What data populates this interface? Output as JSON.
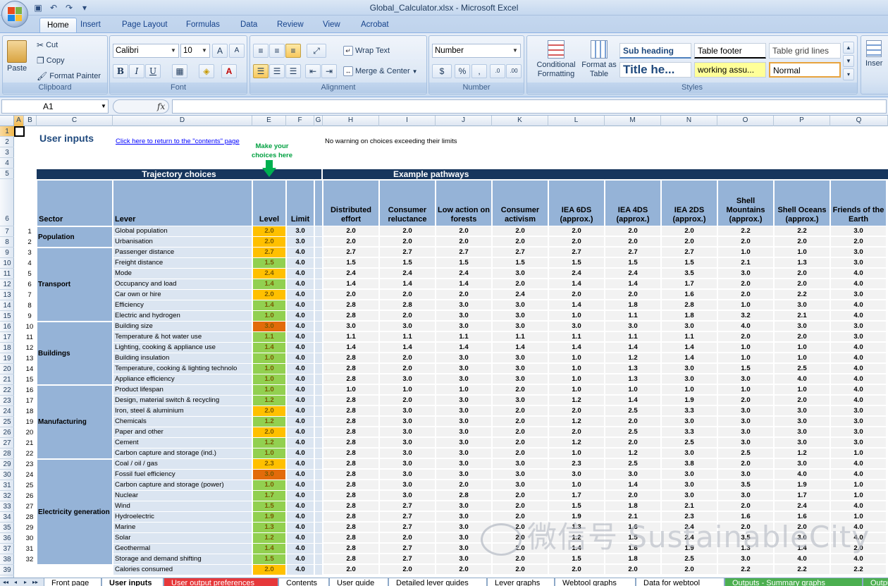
{
  "window": {
    "title": "Global_Calculator.xlsx - Microsoft Excel"
  },
  "ribbon": {
    "tabs": [
      "Home",
      "Insert",
      "Page Layout",
      "Formulas",
      "Data",
      "Review",
      "View",
      "Acrobat"
    ],
    "clipboard": {
      "paste": "Paste",
      "cut": "Cut",
      "copy": "Copy",
      "format_painter": "Format Painter",
      "label": "Clipboard"
    },
    "font": {
      "name": "Calibri",
      "size": "10",
      "label": "Font",
      "bold": "B",
      "italic": "I",
      "underline": "U"
    },
    "alignment": {
      "wrap_text": "Wrap Text",
      "merge_center": "Merge & Center",
      "label": "Alignment"
    },
    "number": {
      "format": "Number",
      "label": "Number",
      "currency": "$",
      "percent": "%",
      "comma": ","
    },
    "styles": {
      "conditional": "Conditional Formatting",
      "format_table": "Format as Table",
      "label": "Styles",
      "cells": [
        {
          "text": "Sub heading"
        },
        {
          "text": "Table footer"
        },
        {
          "text": "Table grid lines"
        },
        {
          "text": "Title he..."
        },
        {
          "text": "working assu..."
        },
        {
          "text": "Normal"
        }
      ]
    },
    "insert_label": "Inser"
  },
  "formula_bar": {
    "name_box": "A1",
    "fx": "fx",
    "content": ""
  },
  "columns": [
    "A",
    "B",
    "C",
    "D",
    "E",
    "F",
    "G",
    "H",
    "I",
    "J",
    "K",
    "L",
    "M",
    "N",
    "O",
    "P",
    "Q"
  ],
  "sheet": {
    "title": "User inputs",
    "contents_link": "Click here to return to the \"contents\" page",
    "warning": "No warning on choices exceeding their limits",
    "make_choices": "Make your choices here",
    "trajectory_header": "Trajectory choices",
    "pathways_header": "Example pathways",
    "headers": {
      "sector": "Sector",
      "lever": "Lever",
      "level": "Level",
      "limit": "Limit",
      "pathways": [
        "Distributed effort",
        "Consumer reluctance",
        "Low action on forests",
        "Consumer activism",
        "IEA 6DS (approx.)",
        "IEA 4DS (approx.)",
        "IEA 2DS (approx.)",
        "Shell Mountains (approx.)",
        "Shell Oceans (approx.)",
        "Friends of the Earth"
      ]
    },
    "sectors": [
      {
        "name": "Population",
        "start": 0,
        "end": 1
      },
      {
        "name": "Transport",
        "start": 2,
        "end": 8
      },
      {
        "name": "Buildings",
        "start": 9,
        "end": 14
      },
      {
        "name": "Manufacturing",
        "start": 15,
        "end": 21
      },
      {
        "name": "Electricity generation",
        "start": 22,
        "end": 31
      }
    ],
    "rows": [
      {
        "n": "1",
        "lever": "Global population",
        "level": "2.0",
        "limit": "3.0",
        "p": [
          "2.0",
          "2.0",
          "2.0",
          "2.0",
          "2.0",
          "2.0",
          "2.0",
          "2.2",
          "2.2",
          "3.0"
        ]
      },
      {
        "n": "2",
        "lever": "Urbanisation",
        "level": "2.0",
        "limit": "3.0",
        "p": [
          "2.0",
          "2.0",
          "2.0",
          "2.0",
          "2.0",
          "2.0",
          "2.0",
          "2.0",
          "2.0",
          "2.0"
        ]
      },
      {
        "n": "3",
        "lever": "Passenger distance",
        "level": "2.7",
        "limit": "4.0",
        "p": [
          "2.7",
          "2.7",
          "2.7",
          "2.7",
          "2.7",
          "2.7",
          "2.7",
          "1.0",
          "1.0",
          "3.0"
        ]
      },
      {
        "n": "4",
        "lever": "Freight distance",
        "level": "1.5",
        "limit": "4.0",
        "p": [
          "1.5",
          "1.5",
          "1.5",
          "1.5",
          "1.5",
          "1.5",
          "1.5",
          "2.1",
          "1.3",
          "3.0"
        ]
      },
      {
        "n": "5",
        "lever": "Mode",
        "level": "2.4",
        "limit": "4.0",
        "p": [
          "2.4",
          "2.4",
          "2.4",
          "3.0",
          "2.4",
          "2.4",
          "3.5",
          "3.0",
          "2.0",
          "4.0"
        ]
      },
      {
        "n": "6",
        "lever": "Occupancy and load",
        "level": "1.4",
        "limit": "4.0",
        "p": [
          "1.4",
          "1.4",
          "1.4",
          "2.0",
          "1.4",
          "1.4",
          "1.7",
          "2.0",
          "2.0",
          "4.0"
        ]
      },
      {
        "n": "7",
        "lever": "Car own or hire",
        "level": "2.0",
        "limit": "4.0",
        "p": [
          "2.0",
          "2.0",
          "2.0",
          "2.4",
          "2.0",
          "2.0",
          "1.6",
          "2.0",
          "2.2",
          "3.0"
        ]
      },
      {
        "n": "8",
        "lever": "Efficiency",
        "level": "1.4",
        "limit": "4.0",
        "p": [
          "2.8",
          "2.8",
          "3.0",
          "3.0",
          "1.4",
          "1.8",
          "2.8",
          "1.0",
          "3.0",
          "4.0"
        ]
      },
      {
        "n": "9",
        "lever": "Electric and hydrogen",
        "level": "1.0",
        "limit": "4.0",
        "p": [
          "2.8",
          "2.0",
          "3.0",
          "3.0",
          "1.0",
          "1.1",
          "1.8",
          "3.2",
          "2.1",
          "4.0"
        ]
      },
      {
        "n": "10",
        "lever": "Building size",
        "level": "3.0",
        "limit": "4.0",
        "p": [
          "3.0",
          "3.0",
          "3.0",
          "3.0",
          "3.0",
          "3.0",
          "3.0",
          "4.0",
          "3.0",
          "3.0"
        ]
      },
      {
        "n": "11",
        "lever": "Temperature & hot water use",
        "level": "1.1",
        "limit": "4.0",
        "p": [
          "1.1",
          "1.1",
          "1.1",
          "1.1",
          "1.1",
          "1.1",
          "1.1",
          "2.0",
          "2.0",
          "3.0"
        ]
      },
      {
        "n": "12",
        "lever": "Lighting, cooking & appliance use",
        "level": "1.4",
        "limit": "4.0",
        "p": [
          "1.4",
          "1.4",
          "1.4",
          "1.4",
          "1.4",
          "1.4",
          "1.4",
          "1.0",
          "1.0",
          "4.0"
        ]
      },
      {
        "n": "13",
        "lever": "Building insulation",
        "level": "1.0",
        "limit": "4.0",
        "p": [
          "2.8",
          "2.0",
          "3.0",
          "3.0",
          "1.0",
          "1.2",
          "1.4",
          "1.0",
          "1.0",
          "4.0"
        ]
      },
      {
        "n": "14",
        "lever": "Temperature, cooking & lighting technolo",
        "level": "1.0",
        "limit": "4.0",
        "p": [
          "2.8",
          "2.0",
          "3.0",
          "3.0",
          "1.0",
          "1.3",
          "3.0",
          "1.5",
          "2.5",
          "4.0"
        ]
      },
      {
        "n": "15",
        "lever": "Appliance efficiency",
        "level": "1.0",
        "limit": "4.0",
        "p": [
          "2.8",
          "3.0",
          "3.0",
          "3.0",
          "1.0",
          "1.3",
          "3.0",
          "3.0",
          "4.0",
          "4.0"
        ]
      },
      {
        "n": "16",
        "lever": "Product lifespan",
        "level": "1.0",
        "limit": "4.0",
        "p": [
          "1.0",
          "1.0",
          "1.0",
          "2.0",
          "1.0",
          "1.0",
          "1.0",
          "1.0",
          "1.0",
          "4.0"
        ]
      },
      {
        "n": "17",
        "lever": "Design, material switch & recycling",
        "level": "1.2",
        "limit": "4.0",
        "p": [
          "2.8",
          "2.0",
          "3.0",
          "3.0",
          "1.2",
          "1.4",
          "1.9",
          "2.0",
          "2.0",
          "4.0"
        ]
      },
      {
        "n": "18",
        "lever": "Iron, steel & aluminium",
        "level": "2.0",
        "limit": "4.0",
        "p": [
          "2.8",
          "3.0",
          "3.0",
          "2.0",
          "2.0",
          "2.5",
          "3.3",
          "3.0",
          "3.0",
          "3.0"
        ]
      },
      {
        "n": "19",
        "lever": "Chemicals",
        "level": "1.2",
        "limit": "4.0",
        "p": [
          "2.8",
          "3.0",
          "3.0",
          "2.0",
          "1.2",
          "2.0",
          "3.0",
          "3.0",
          "3.0",
          "3.0"
        ]
      },
      {
        "n": "20",
        "lever": "Paper and other",
        "level": "2.0",
        "limit": "4.0",
        "p": [
          "2.8",
          "3.0",
          "3.0",
          "2.0",
          "2.0",
          "2.5",
          "3.3",
          "3.0",
          "3.0",
          "3.0"
        ]
      },
      {
        "n": "21",
        "lever": "Cement",
        "level": "1.2",
        "limit": "4.0",
        "p": [
          "2.8",
          "3.0",
          "3.0",
          "2.0",
          "1.2",
          "2.0",
          "2.5",
          "3.0",
          "3.0",
          "3.0"
        ]
      },
      {
        "n": "22",
        "lever": "Carbon capture and storage (ind.)",
        "level": "1.0",
        "limit": "4.0",
        "p": [
          "2.8",
          "3.0",
          "3.0",
          "2.0",
          "1.0",
          "1.2",
          "3.0",
          "2.5",
          "1.2",
          "1.0"
        ]
      },
      {
        "n": "23",
        "lever": "Coal / oil / gas",
        "level": "2.3",
        "limit": "4.0",
        "p": [
          "2.8",
          "3.0",
          "3.0",
          "3.0",
          "2.3",
          "2.5",
          "3.8",
          "2.0",
          "3.0",
          "4.0"
        ]
      },
      {
        "n": "24",
        "lever": "Fossil fuel efficiency",
        "level": "3.0",
        "limit": "4.0",
        "p": [
          "2.8",
          "3.0",
          "3.0",
          "3.0",
          "3.0",
          "3.0",
          "3.0",
          "3.0",
          "4.0",
          "4.0"
        ]
      },
      {
        "n": "25",
        "lever": "Carbon capture and storage (power)",
        "level": "1.0",
        "limit": "4.0",
        "p": [
          "2.8",
          "3.0",
          "2.0",
          "3.0",
          "1.0",
          "1.4",
          "3.0",
          "3.5",
          "1.9",
          "1.0"
        ]
      },
      {
        "n": "26",
        "lever": "Nuclear",
        "level": "1.7",
        "limit": "4.0",
        "p": [
          "2.8",
          "3.0",
          "2.8",
          "2.0",
          "1.7",
          "2.0",
          "3.0",
          "3.0",
          "1.7",
          "1.0"
        ]
      },
      {
        "n": "27",
        "lever": "Wind",
        "level": "1.5",
        "limit": "4.0",
        "p": [
          "2.8",
          "2.7",
          "3.0",
          "2.0",
          "1.5",
          "1.8",
          "2.1",
          "2.0",
          "2.4",
          "4.0"
        ]
      },
      {
        "n": "28",
        "lever": "Hydroelectric",
        "level": "1.9",
        "limit": "4.0",
        "p": [
          "2.8",
          "2.7",
          "3.0",
          "2.0",
          "1.9",
          "2.1",
          "2.3",
          "1.6",
          "1.6",
          "1.0"
        ]
      },
      {
        "n": "29",
        "lever": "Marine",
        "level": "1.3",
        "limit": "4.0",
        "p": [
          "2.8",
          "2.7",
          "3.0",
          "2.0",
          "1.3",
          "1.6",
          "2.4",
          "2.0",
          "2.0",
          "4.0"
        ]
      },
      {
        "n": "30",
        "lever": "Solar",
        "level": "1.2",
        "limit": "4.0",
        "p": [
          "2.8",
          "2.0",
          "3.0",
          "2.0",
          "1.2",
          "1.5",
          "2.4",
          "3.5",
          "3.0",
          "4.0"
        ]
      },
      {
        "n": "31",
        "lever": "Geothermal",
        "level": "1.4",
        "limit": "4.0",
        "p": [
          "2.8",
          "2.7",
          "3.0",
          "2.0",
          "1.4",
          "1.6",
          "1.9",
          "1.3",
          "1.4",
          "2.0"
        ]
      },
      {
        "n": "32",
        "lever": "Storage and demand shifting",
        "level": "1.5",
        "limit": "4.0",
        "p": [
          "2.8",
          "2.7",
          "3.0",
          "2.0",
          "1.5",
          "1.8",
          "2.5",
          "3.0",
          "4.0",
          "4.0"
        ]
      },
      {
        "n": "",
        "lever": "Calories consumed",
        "level": "2.0",
        "limit": "4.0",
        "p": [
          "2.0",
          "2.0",
          "2.0",
          "2.0",
          "2.0",
          "2.0",
          "2.0",
          "2.2",
          "2.2",
          "2.2"
        ]
      }
    ]
  },
  "sheet_tabs": [
    "Front page",
    "User inputs",
    "User output preferences",
    "Contents",
    "User guide",
    "Detailed lever guides",
    "Lever graphs",
    "Webtool graphs",
    "Data for webtool",
    "Outputs - Summary graphs",
    "Outpu"
  ],
  "watermark": "微信号 SustainableCity",
  "colors": {
    "header_navy": "#17365d",
    "header_blue": "#95b3d7",
    "lever_bg": "#dbe5f1",
    "level_green": "#92d050",
    "level_yellow": "#ffc000",
    "level_orange": "#e26b0a",
    "arrow_green": "#00b050"
  }
}
